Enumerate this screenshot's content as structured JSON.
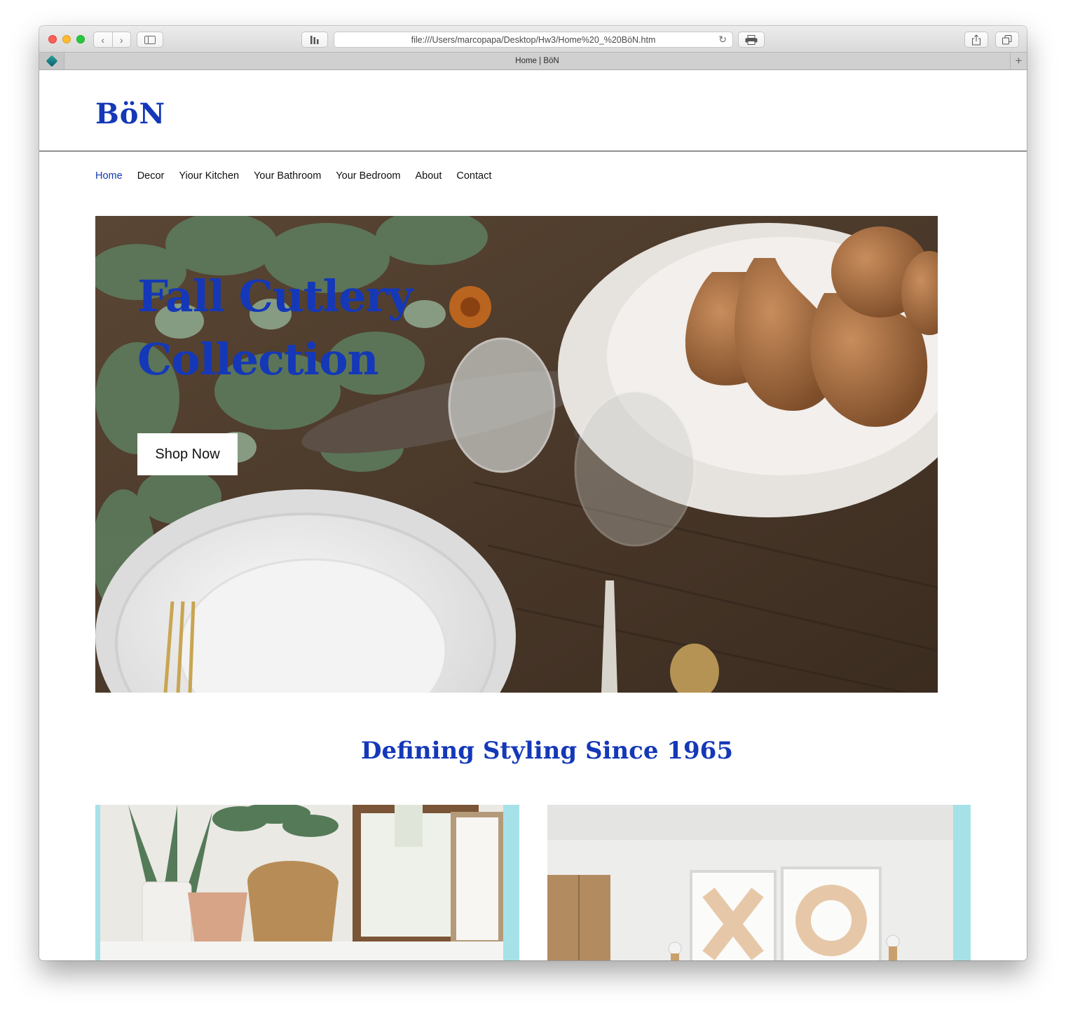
{
  "browser": {
    "url": "file:///Users/marcopapa/Desktop/Hw3/Home%20_%20BöN.htm",
    "tab_title": "Home | BöN",
    "new_tab_label": "+"
  },
  "site": {
    "logo": "BöN",
    "nav": [
      {
        "label": "Home",
        "active": true
      },
      {
        "label": "Decor"
      },
      {
        "label": "Yiour Kitchen"
      },
      {
        "label": "Your Bathroom"
      },
      {
        "label": "Your Bedroom"
      },
      {
        "label": "About"
      },
      {
        "label": "Contact"
      }
    ],
    "hero": {
      "title_line1": "Fall Cutlery",
      "title_line2": "Collection",
      "button": "Shop Now"
    },
    "tagline": "Defining Styling Since 1965",
    "colors": {
      "brand_blue": "#1438b8",
      "card_accent": "#a7e1e8"
    }
  }
}
